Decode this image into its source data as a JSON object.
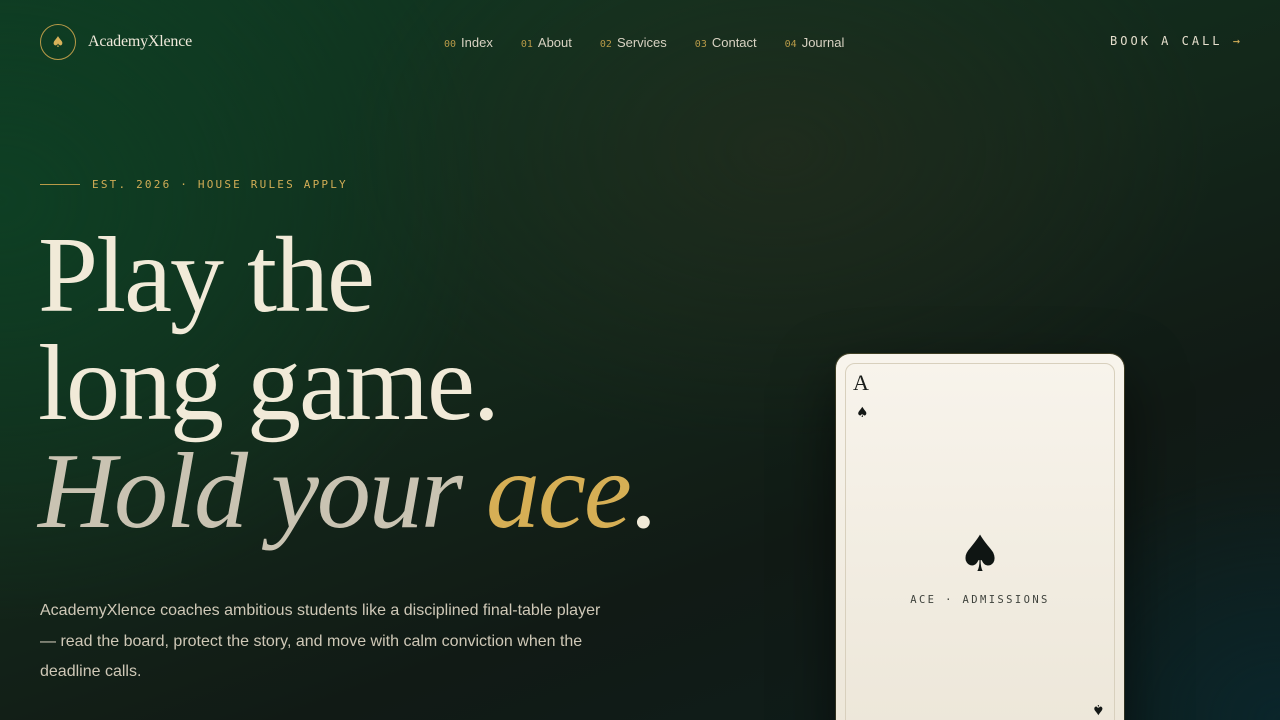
{
  "brand": {
    "mark_icon": "spade-icon",
    "mark_glyph": "♠",
    "name": "AcademyXlence"
  },
  "nav": {
    "items": [
      {
        "num": "00",
        "label": "Index"
      },
      {
        "num": "01",
        "label": "About"
      },
      {
        "num": "02",
        "label": "Services"
      },
      {
        "num": "03",
        "label": "Contact"
      },
      {
        "num": "04",
        "label": "Journal"
      }
    ]
  },
  "cta": {
    "label": "BOOK A CALL",
    "arrow": "→"
  },
  "hero": {
    "eyebrow": "EST. 2026 · HOUSE RULES APPLY",
    "line1": "Play the",
    "line2": "long game.",
    "line3_part1": "Hold your ",
    "line3_accent": "ace",
    "line3_end": ".",
    "lede": "AcademyXlence coaches ambitious students like a disciplined final-table player — read the board, protect the story, and move with calm conviction when the deadline calls."
  },
  "card": {
    "rank": "A",
    "suit_icon": "spade-icon",
    "suit_glyph": "♠",
    "caption": "ACE · ADMISSIONS"
  },
  "colors": {
    "accent_gold": "#d6af55",
    "background_green": "#13271a",
    "cream": "#f1ead8"
  }
}
